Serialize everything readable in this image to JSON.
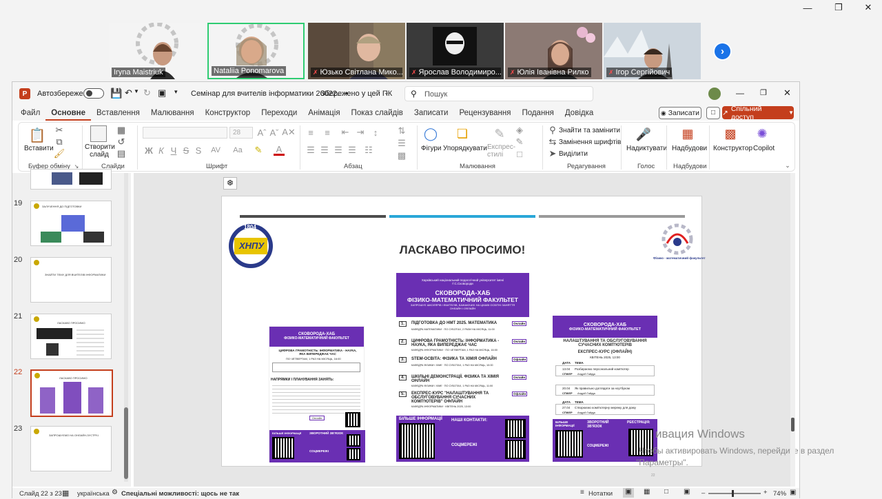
{
  "zoom": {
    "participants": [
      {
        "name": "Iryna Maistriuk",
        "muted": false
      },
      {
        "name": "Nataliia Ponomarova",
        "muted": false
      },
      {
        "name": "Юзько Світлана Мико...",
        "muted": true
      },
      {
        "name": "Ярослав Володимиро...",
        "muted": true
      },
      {
        "name": "Юлія Іванівна Рилко",
        "muted": true
      },
      {
        "name": "Ігор Сергійович",
        "muted": true
      }
    ],
    "colors": {
      "active_speaker": "#2ecc71",
      "next_button": "#1a73e8"
    }
  },
  "titlebar": {
    "autosave_label": "Автозбереження",
    "doc_title": "Семінар для вчителів інформатики 26022... •",
    "save_status": "Збережено у цей ПК",
    "search_placeholder": "Пошук"
  },
  "menu": [
    "Файл",
    "Основне",
    "Вставлення",
    "Малювання",
    "Конструктор",
    "Переходи",
    "Анімація",
    "Показ слайдів",
    "Записати",
    "Рецензування",
    "Подання",
    "Довідка"
  ],
  "menu_active": "Основне",
  "record_btn": "Записати",
  "share_btn": "Спільний доступ",
  "ribbon": {
    "paste": "Вставити",
    "new_slide": "Створити слайд",
    "font_size": "28",
    "groups": {
      "clipboard": "Буфер обміну",
      "slides": "Слайди",
      "font": "Шрифт",
      "paragraph": "Абзац",
      "drawing": "Малювання",
      "editing": "Редагування",
      "voice": "Голос",
      "addins": "Надбудови"
    },
    "shapes": "Фігури",
    "arrange": "Упорядкувати",
    "express": "Експрес-стилі",
    "find_replace": "Знайти та замінити",
    "replace_font": "Замінення шрифтів",
    "select": "Виділити",
    "dictate": "Надиктувати",
    "addins": "Надбудови",
    "designer": "Конструктор",
    "copilot": "Copilot"
  },
  "thumbnails": [
    {
      "num": "19",
      "title": "ЗАЛУЧЕННЯ ДО ПІДГОТОВКИ"
    },
    {
      "num": "20",
      "title": "ЗНАЙТИ ТЕМУ ДЛЯ ВЧИТЕЛІВ ІНФОРМАТИКИ"
    },
    {
      "num": "21",
      "title": "ЛАСКАВО ПРОСИМО"
    },
    {
      "num": "22",
      "title": "ЛАСКАВО ПРОСИМО"
    },
    {
      "num": "23",
      "title": "ЗАПРОШУЄМО НА ОНЛАЙН-ЗУСТРІЧ"
    }
  ],
  "selected_slide": "22",
  "slide": {
    "welcome": "ЛАСКАВО ПРОСИМО!",
    "faculty_caption": "Фізико - математичний факультет",
    "logo_year": "1804",
    "logo_name": "ХНПУ",
    "page_number": "22",
    "poster_center": {
      "uni": "Харківський національний педагогічний університет імені Г.С.Сковороди",
      "hub": "СКОВОРОДА-ХАБ",
      "faculty": "ФІЗИКО-МАТЕМАТИЧНИЙ ФАКУЛЬТЕТ",
      "invite": "ЗАПРОШУЄ ШКОЛЯРІВ І ВЧИТЕЛІВ, БАЖАЮЧИХ НА ЦІКАВІ ОСВІТНІ ЗАНЯТТЯ ОНЛАЙН І ОФЛАЙН",
      "items": [
        {
          "n": "1.",
          "text": "ПІДГОТОВКА ДО НМТ 2025. МАТЕМАТИКА",
          "tag": "Онлайн",
          "sub": "КАФЕДРА МАТЕМАТИКИ · ПО СУБОТАХ, 2 РАЗИ НА МІСЯЦЬ, 11:00"
        },
        {
          "n": "2.",
          "text": "ЦИФРОВА ГРАМОТНІСТЬ: ІНФОРМАТИКА - НАУКА, ЯКА ВИПЕРЕДЖАЄ ЧАС",
          "tag": "Онлайн",
          "sub": "КАФЕДРА ІНФОРМАТИКИ · ПО ЧЕТВЕРГАМ, 1 РАЗ НА МІСЯЦЬ, 16:00"
        },
        {
          "n": "3.",
          "text": "STEM-ОСВІТА: ФІЗИКА ТА ХІМІЯ ОФЛАЙН",
          "tag": "Офлайн",
          "sub": "КАФЕДРА ФІЗИКИ І ХІМІЇ · ПО СУБОТАХ, 1 РАЗ НА МІСЯЦЬ, 10:00"
        },
        {
          "n": "4.",
          "text": "ШКІЛЬНІ ДЕМОНСТРАЦІЇ. ФІЗИКА ТА ХІМІЯ ОНЛАЙН",
          "tag": "Онлайн",
          "sub": "КАФЕДРА ФІЗИКИ І ХІМІЇ · ПО СУБОТАХ, 1 РАЗ НА МІСЯЦЬ, 11:00"
        },
        {
          "n": "5.",
          "text": "ЕКСПРЕС-КУРС \"НАЛАШТУВАННЯ ТА ОБСЛУГОВУВАННЯ СУЧАСНИХ КОМП'ЮТЕРІВ\" ОФЛАЙН",
          "tag": "Офлайн",
          "sub": "КАФЕДРА ІНФОРМАТИКИ · КВІТЕНЬ 2025, 13:00"
        }
      ],
      "more_info": "БІЛЬШЕ ІНФОРМАЦІЇ",
      "contacts": "НАШІ КОНТАКТИ:",
      "socials": "СОЦМЕРЕЖІ"
    },
    "poster_left": {
      "hub": "СКОВОРОДА-ХАБ",
      "faculty": "ФІЗИКО-МАТЕМАТИЧНИЙ ФАКУЛЬТЕТ",
      "course": "ЦИФРОВА ГРАМОТНІСТЬ: ІНФОРМАТИКА - НАУКА, ЯКА ВИПЕРЕДЖАЄ ЧАС",
      "schedule": "ПО ЧЕТВЕРГАМ, 1 РАЗ НА МІСЯЦЬ, 16:00",
      "plan": "НАПРЯМКИ І ПЛАНУВАННЯ ЗАНЯТЬ:",
      "date_label": "Онлайн",
      "more_info": "БІЛЬШЕ ІНФОРМАЦІЇ",
      "feedback": "ЗВОРОТНИЙ ЗВ'ЯЗОК",
      "socials": "СОЦМЕРЕЖІ"
    },
    "poster_right": {
      "hub": "СКОВОРОДА-ХАБ",
      "faculty": "ФІЗИКО-МАТЕМАТИЧНИЙ ФАКУЛЬТЕТ",
      "course": "НАЛАШТУВАННЯ ТА ОБСЛУГОВУВАННЯ СУЧАСНИХ КОМП'ЮТЕРІВ",
      "format": "ЕКСПРЕС-КУРС (ОФЛАЙН)",
      "month": "КВІТЕНЬ 2025, 13:00",
      "rows": [
        {
          "date": "13.04",
          "topic": "Розбираємо персональний комп'ютер",
          "speaker": "Андрій Гайдук"
        },
        {
          "date": "20.04",
          "topic": "Як правильно доглядати за ноутбуком",
          "speaker": "Андрій Гайдук"
        },
        {
          "date": "27.04",
          "topic": "Створюємо комп'ютерну мережу для дому",
          "speaker": "Андрій Гайдук"
        }
      ],
      "col_date": "ДАТА",
      "col_topic": "ТЕМА",
      "col_speaker": "СПІКЕР",
      "more_info": "БІЛЬШЕ ІНФОРМАЦІЇ",
      "feedback": "ЗВОРОТНИЙ ЗВ'ЯЗОК",
      "registration": "РЕЄСТРАЦІЯ:",
      "socials": "СОЦМЕРЕЖІ"
    },
    "colors": {
      "purple": "#6a2fb3",
      "bar_dark": "#4d4d4d",
      "bar_blue": "#2aa7d8",
      "bar_gray": "#9a9a9a",
      "title": "#333333"
    }
  },
  "watermark": {
    "title": "ивация Windows",
    "line1": "Чтобы активировать Windows, перейдите в раздел",
    "line2": "\"Параметры\"."
  },
  "status": {
    "slide_info": "Слайд 22 з 23",
    "language": "українська",
    "accessibility": "Спеціальні можливості: щось не так",
    "notes": "Нотатки",
    "zoom": "74%"
  }
}
